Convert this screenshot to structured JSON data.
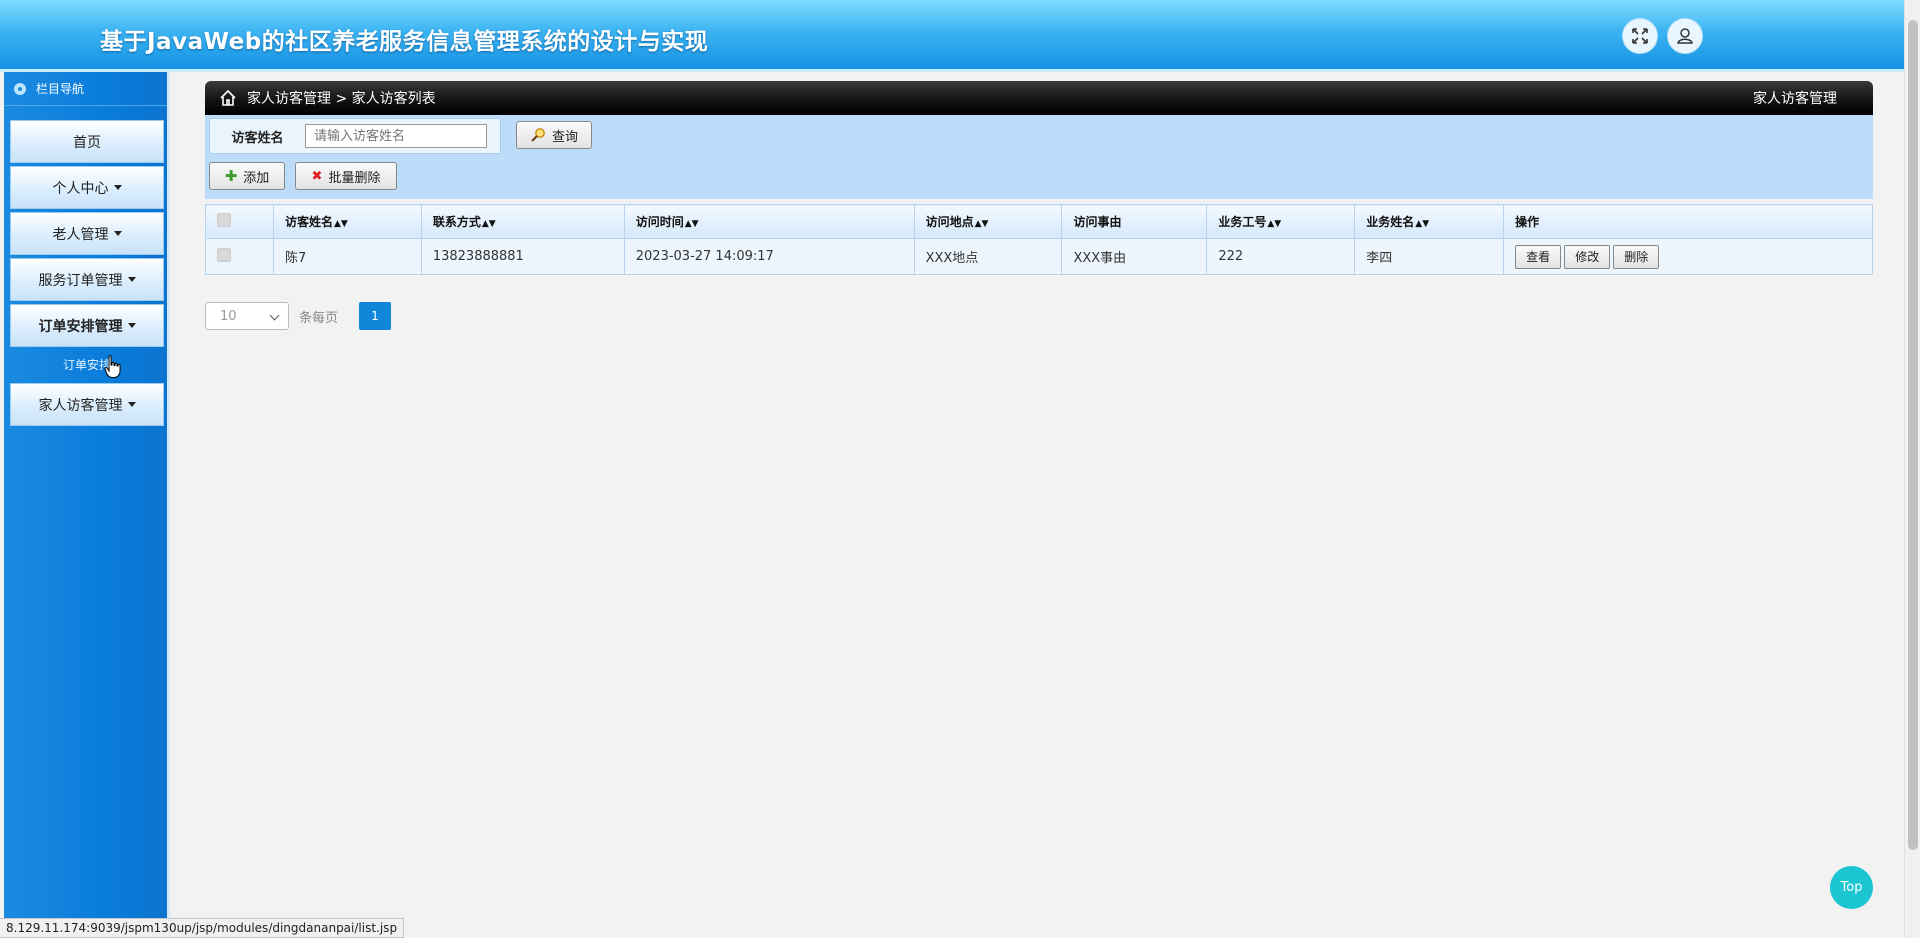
{
  "header": {
    "title": "基于JavaWeb的社区养老服务信息管理系统的设计与实现",
    "fullscreen_icon": "fullscreen-icon",
    "user_icon": "user-icon"
  },
  "sidebar": {
    "heading": "栏目导航",
    "items": [
      {
        "label": "首页",
        "dropdown": false
      },
      {
        "label": "个人中心",
        "dropdown": true
      },
      {
        "label": "老人管理",
        "dropdown": true
      },
      {
        "label": "服务订单管理",
        "dropdown": true
      },
      {
        "label": "订单安排管理",
        "dropdown": true
      },
      {
        "label": "家人访客管理",
        "dropdown": true
      }
    ],
    "submenu_label": "订单安排"
  },
  "breadcrumb": {
    "path": "家人访客管理 > 家人访客列表",
    "right_title": "家人访客管理"
  },
  "search": {
    "label": "访客姓名",
    "placeholder": "请输入访客姓名",
    "query_button": "查询"
  },
  "actions": {
    "add_button": "添加",
    "batch_delete_button": "批量删除"
  },
  "table": {
    "columns": [
      "访客姓名",
      "联系方式",
      "访问时间",
      "访问地点",
      "访问事由",
      "业务工号",
      "业务姓名",
      "操作"
    ],
    "rows": [
      {
        "visitor_name": "陈7",
        "phone": "13823888881",
        "visit_time": "2023-03-27 14:09:17",
        "location": "XXX地点",
        "reason": "XXX事由",
        "staff_id": "222",
        "staff_name": "李四",
        "ops": [
          "查看",
          "修改",
          "删除"
        ]
      }
    ]
  },
  "pagination": {
    "page_size": "10",
    "page_size_label": "条每页",
    "current_page": "1"
  },
  "top_button": "Top",
  "status_url": "8.129.11.174:9039/jspm130up/jsp/modules/dingdananpai/list.jsp",
  "colors": {
    "header_blue": "#1592e3",
    "sidebar_blue": "#0a7ddb",
    "panel_blue": "#bcdcf9",
    "top_button": "#1bc6d2",
    "page_active": "#0f86d8"
  }
}
